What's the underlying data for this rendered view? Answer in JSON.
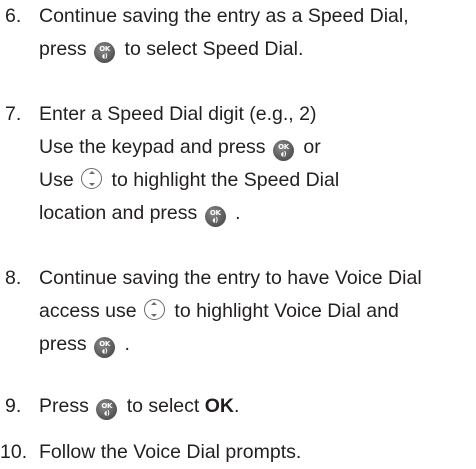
{
  "steps": [
    {
      "number": "6.",
      "line1": "Continue saving the entry as a Speed Dial,",
      "line2_pre": "press",
      "line2_post": "to select Speed Dial."
    },
    {
      "number": "7.",
      "line1": "Enter a Speed Dial digit (e.g., 2)",
      "line2_pre": "Use the keypad and press",
      "line2_post": "or",
      "line3_pre": "Use",
      "line3_post": "to highlight the Speed Dial",
      "line4_pre": "location and press",
      "line4_post": "."
    },
    {
      "number": "8.",
      "line1": "Continue saving the entry to have Voice Dial",
      "line2_pre": "access use",
      "line2_post": "to highlight Voice Dial and",
      "line3_pre": "press",
      "line3_post": "."
    },
    {
      "number": "9.",
      "line1_pre": "Press",
      "line1_mid": "to select",
      "line1_bold": "OK",
      "line1_post": "."
    },
    {
      "number": "10.",
      "line1": "Follow the Voice Dial prompts."
    }
  ],
  "icons": {
    "ok_key_label": "OK",
    "ok_key_name": "ok-key-icon",
    "nav_key_name": "navigation-key-icon"
  }
}
